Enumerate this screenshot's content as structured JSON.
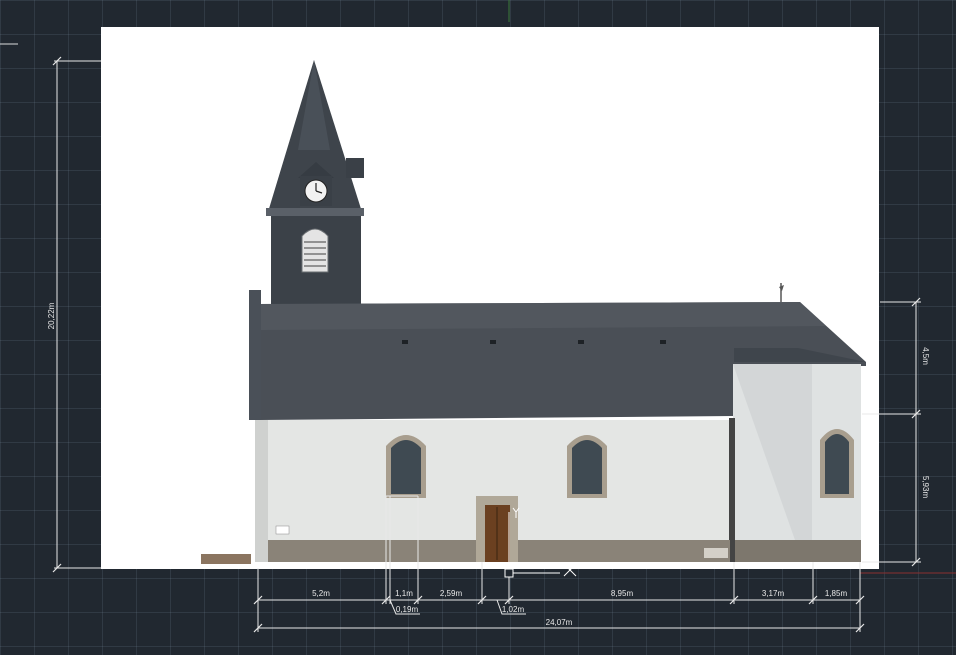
{
  "colors": {
    "background": "#212830",
    "sheet": "#ffffff",
    "dim_line": "#e8e8e8",
    "wall": "#e6e8e6",
    "roof": "#4a4f56",
    "tower": "#3b4148",
    "stone_base": "#8a8378",
    "window": "#3f4a52",
    "door": "#6b4020"
  },
  "icons": [
    "ucs-y-axis-icon",
    "ucs-x-axis-icon",
    "clock-icon",
    "louvre-vent-icon",
    "weathercock-icon"
  ],
  "dimensions": {
    "total_height": "20,22m",
    "upper_right_height": "4,5m",
    "lower_right_height": "5,93m",
    "seg_1": "5,2m",
    "seg_2": "1,1m",
    "seg_3": "2,59m",
    "seg_4": "8,95m",
    "seg_5": "3,17m",
    "seg_6": "1,85m",
    "leader_1": "0,19m",
    "leader_2": "1,02m",
    "total_width": "24,07m"
  }
}
